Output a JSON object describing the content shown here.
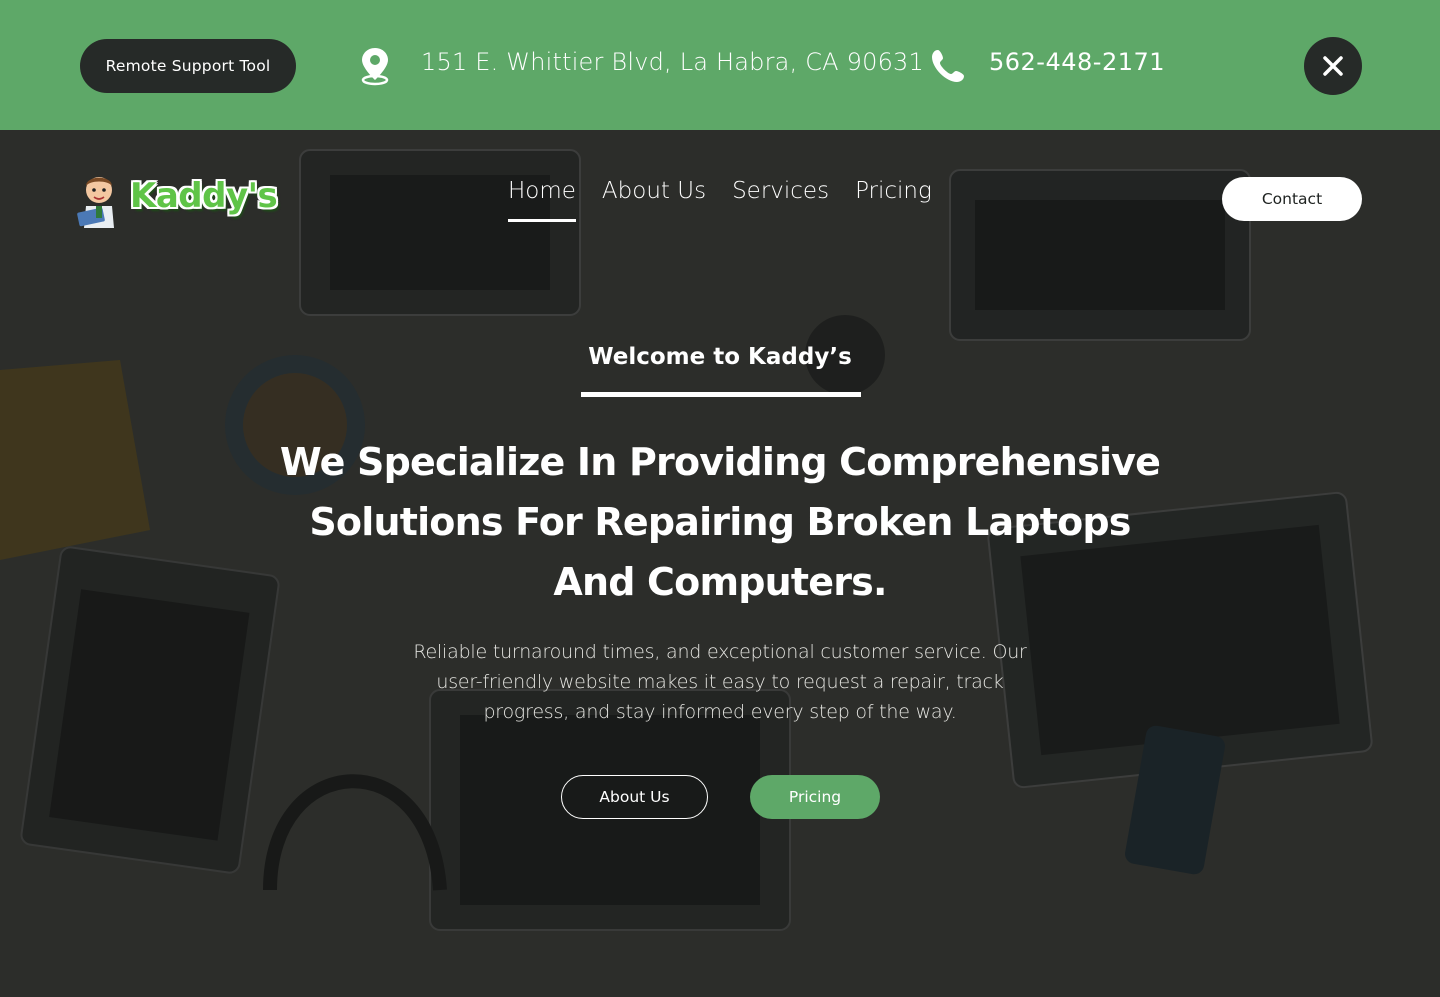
{
  "colors": {
    "brand_green": "#5ea868",
    "dark_pill": "#262a28",
    "logo_green": "#5fc447",
    "white": "#ffffff"
  },
  "topbar": {
    "remote_support_label": "Remote Support Tool",
    "address_icon": "location-pin-icon",
    "address": "151 E. Whittier Blvd, La Habra, CA 90631",
    "phone_icon": "phone-icon",
    "phone": "562-448-2171",
    "close_icon": "close-icon"
  },
  "header": {
    "logo_text": "Kaddy's",
    "nav": [
      {
        "label": "Home",
        "active": true
      },
      {
        "label": "About Us",
        "active": false
      },
      {
        "label": "Services",
        "active": false
      },
      {
        "label": "Pricing",
        "active": false
      }
    ],
    "contact_label": "Contact"
  },
  "hero": {
    "eyebrow": "Welcome to Kaddy’s",
    "headline": "We Specialize In Providing Comprehensive Solutions For Repairing Broken Laptops And Computers.",
    "subtext": "Reliable turnaround times, and exceptional customer service. Our user-friendly website makes it easy to request a repair, track progress, and stay informed every step of the way.",
    "buttons": {
      "about_label": "About Us",
      "pricing_label": "Pricing"
    }
  }
}
